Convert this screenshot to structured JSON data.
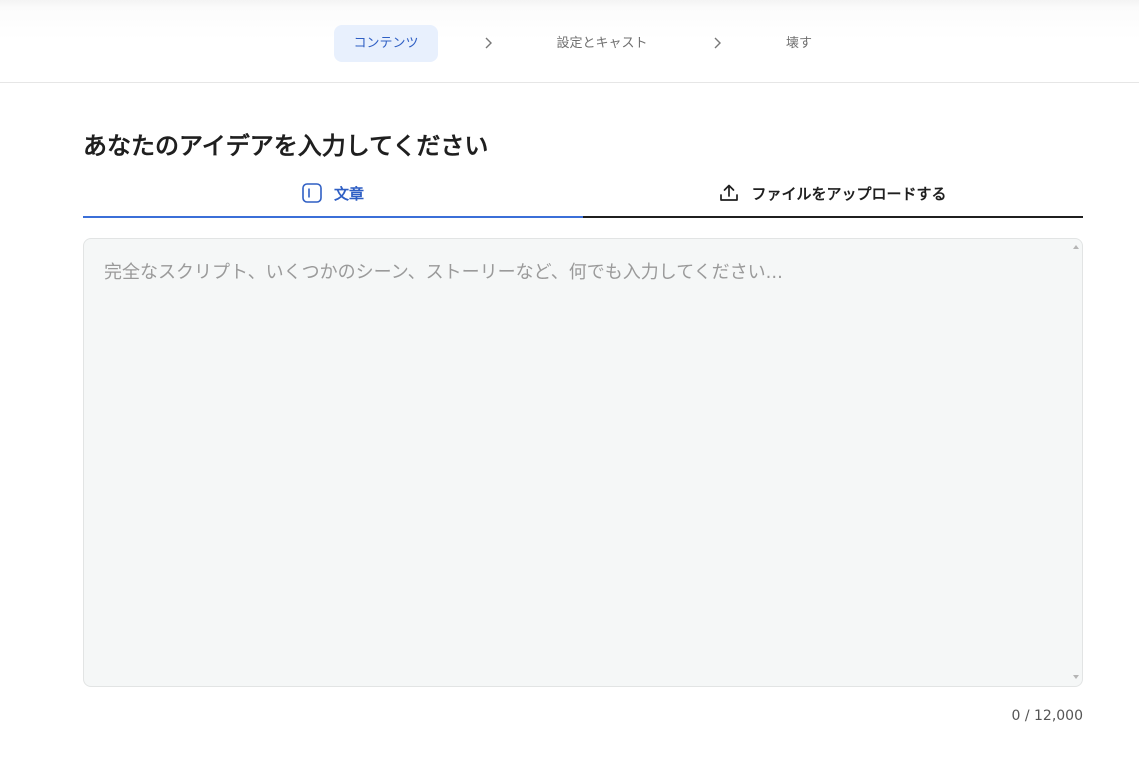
{
  "stepper": {
    "steps": [
      {
        "label": "コンテンツ",
        "state": "active"
      },
      {
        "label": "設定とキャスト",
        "state": "inactive"
      },
      {
        "label": "壊す",
        "state": "inactive"
      }
    ],
    "separator_icon": "chevron-right-icon"
  },
  "main": {
    "title": "あなたのアイデアを入力してください",
    "tabs": [
      {
        "label": "文章",
        "icon": "text-cursor-icon",
        "selected": true
      },
      {
        "label": "ファイルをアップロードする",
        "icon": "upload-icon",
        "selected": false
      }
    ],
    "editor": {
      "value": "",
      "placeholder": "完全なスクリプト、いくつかのシーン、ストーリーなど、何でも入力してください..."
    },
    "char_counter": "0 / 12,000"
  },
  "colors": {
    "accent": "#2f5fc4",
    "accent_bg": "#e8f0fd",
    "editor_bg": "#f5f7f7",
    "text_dark": "#1f1f1f"
  }
}
